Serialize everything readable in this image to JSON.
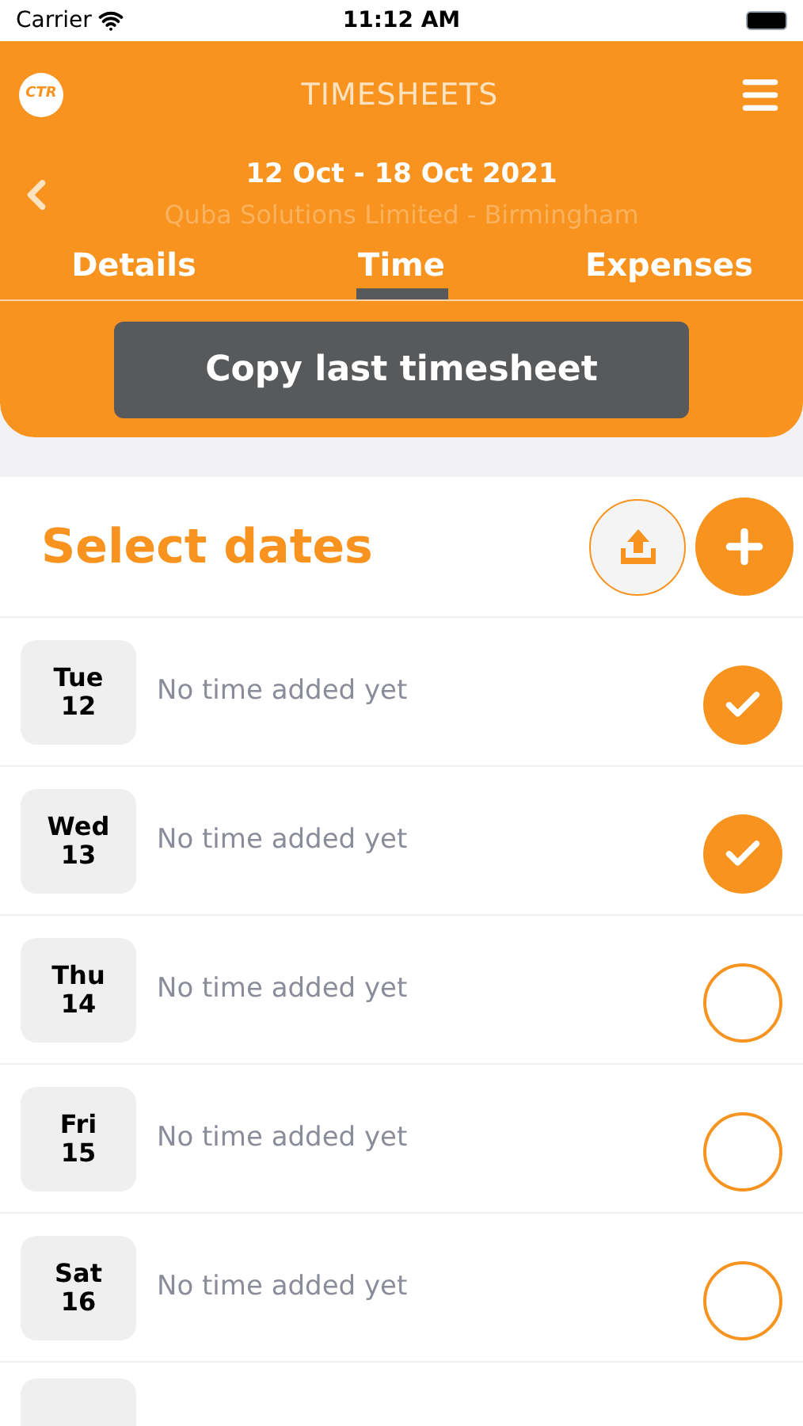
{
  "status_bar": {
    "carrier": "Carrier",
    "time": "11:12 AM"
  },
  "header": {
    "logo_text": "CTR",
    "title": "TIMESHEETS",
    "date_range": "12 Oct - 18 Oct 2021",
    "subtitle": "Quba Solutions Limited - Birmingham"
  },
  "tabs": [
    {
      "label": "Details",
      "selected": false
    },
    {
      "label": "Time",
      "selected": true
    },
    {
      "label": "Expenses",
      "selected": false
    }
  ],
  "copy_button": "Copy last timesheet",
  "section_title": "Select dates",
  "days": [
    {
      "day": "Tue",
      "date": "12",
      "status": "No time added yet",
      "checked": true
    },
    {
      "day": "Wed",
      "date": "13",
      "status": "No time added yet",
      "checked": true
    },
    {
      "day": "Thu",
      "date": "14",
      "status": "No time added yet",
      "checked": false
    },
    {
      "day": "Fri",
      "date": "15",
      "status": "No time added yet",
      "checked": false
    },
    {
      "day": "Sat",
      "date": "16",
      "status": "No time added yet",
      "checked": false
    }
  ]
}
